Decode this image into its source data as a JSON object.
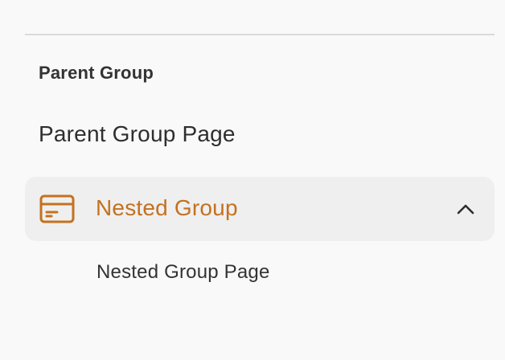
{
  "sidebar": {
    "group_heading": "Parent Group",
    "parent_page_link": "Parent Group Page",
    "nested_group": {
      "label": "Nested Group",
      "icon": "credit-card-icon",
      "toggle_icon": "chevron-up-icon",
      "expanded": true,
      "accent_color": "#c4711f",
      "pages": [
        {
          "label": "Nested Group Page"
        }
      ]
    }
  }
}
